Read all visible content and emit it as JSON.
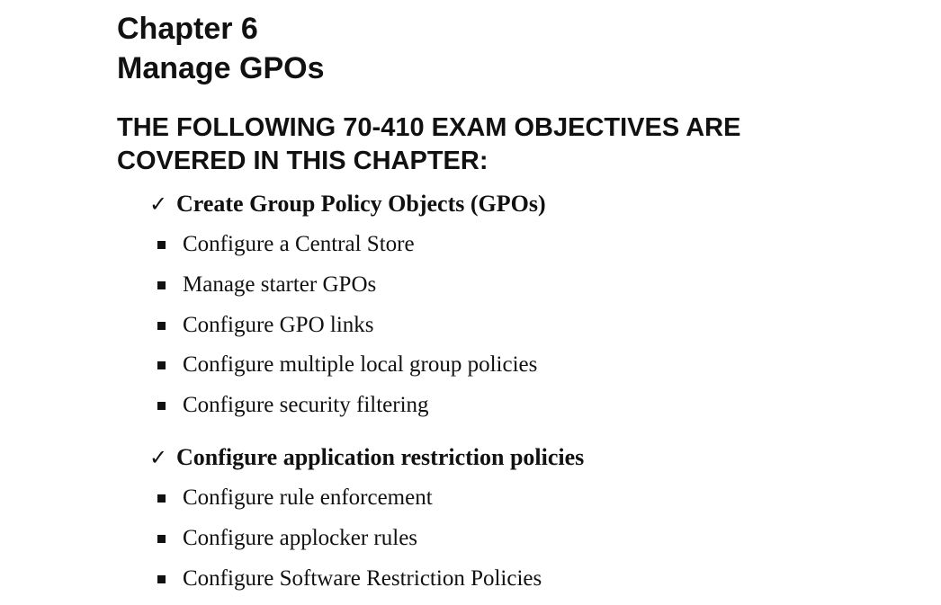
{
  "chapter": {
    "number_line": "Chapter 6",
    "title": "Manage GPOs"
  },
  "objectives_heading": {
    "line1": "THE FOLLOWING 70-410 EXAM OBJECTIVES ARE",
    "line2": "COVERED IN THIS CHAPTER:"
  },
  "sections": [
    {
      "check_symbol": "✓",
      "title": "Create Group Policy Objects (GPOs)",
      "items": [
        "Configure a Central Store",
        "Manage starter GPOs",
        "Configure GPO links",
        "Configure multiple local group policies",
        "Configure security filtering"
      ]
    },
    {
      "check_symbol": "✓",
      "title": "Configure application restriction policies",
      "items": [
        "Configure rule enforcement",
        "Configure applocker rules",
        "Configure Software Restriction Policies"
      ]
    }
  ]
}
